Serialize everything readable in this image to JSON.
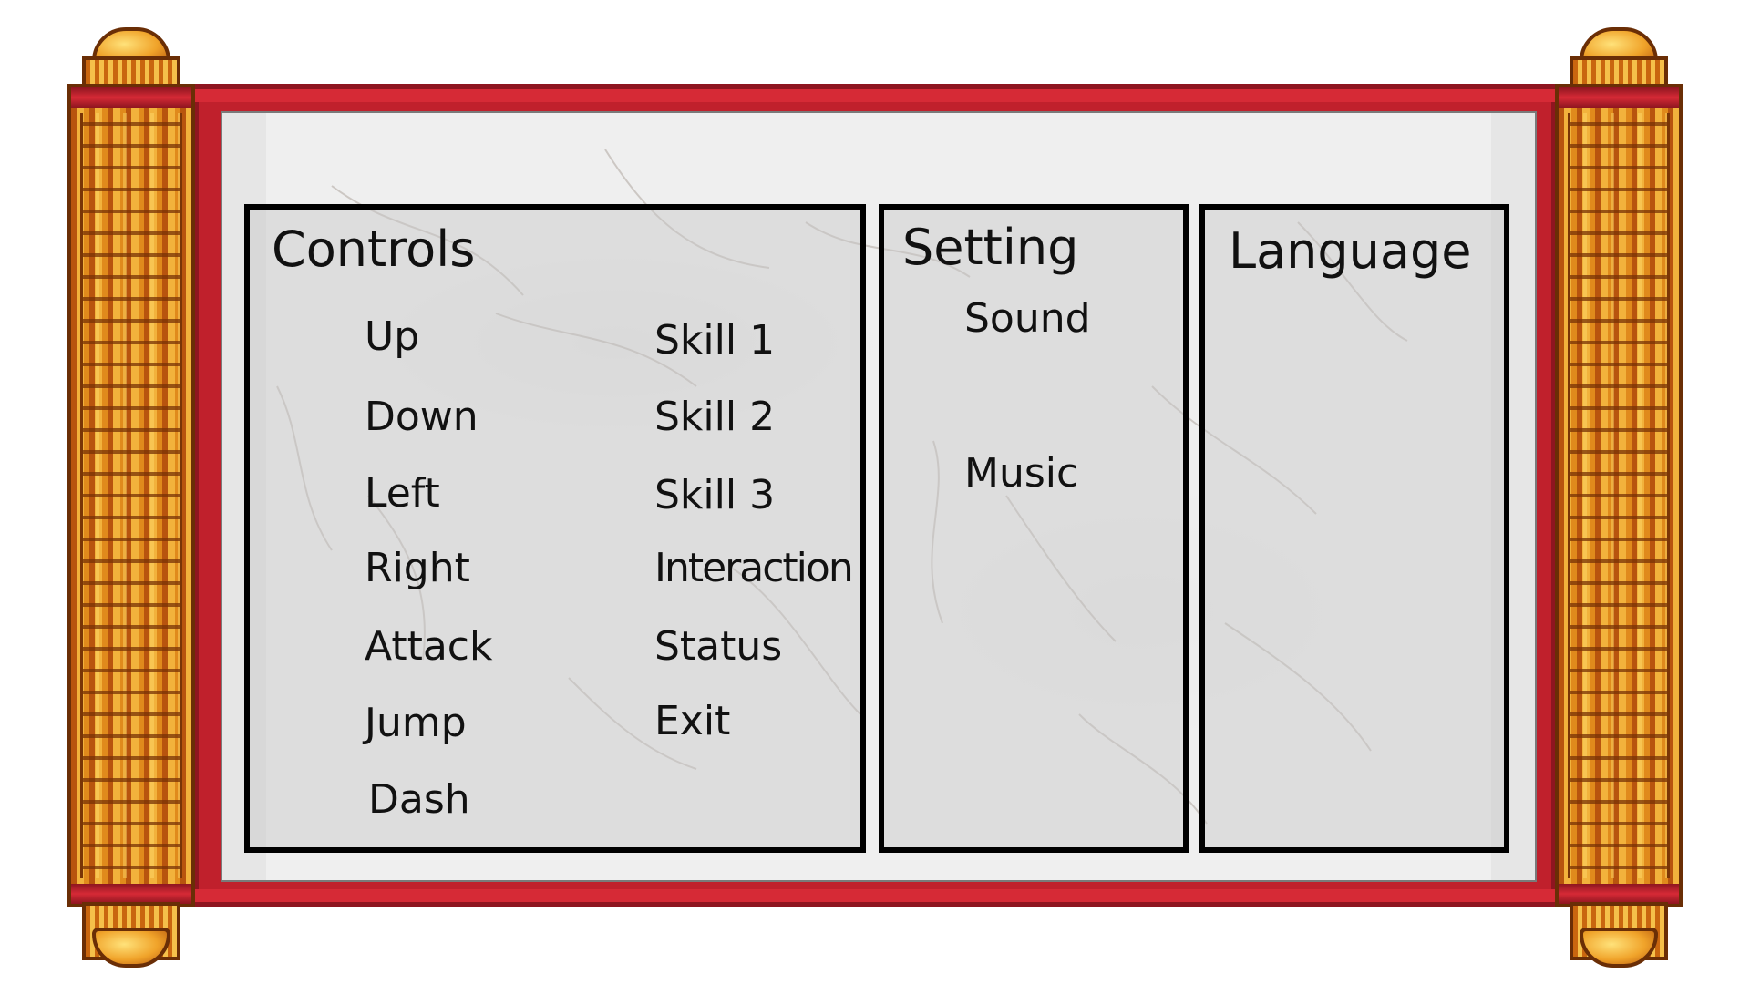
{
  "controls": {
    "title": "Controls",
    "left_items": [
      "Up",
      "Down",
      "Left",
      "Right",
      "Attack",
      "Jump",
      "Dash"
    ],
    "right_items": [
      "Skill 1",
      "Skill 2",
      "Skill 3",
      "Interaction",
      "Status",
      "Exit"
    ]
  },
  "setting": {
    "title": "Setting",
    "items": [
      "Sound",
      "Music"
    ]
  },
  "language": {
    "title": "Language"
  },
  "colors": {
    "frame_red": "#c0202c",
    "roller_gold": "#e08a1c",
    "panel_border": "#000000",
    "paper": "#e6e6e6"
  }
}
